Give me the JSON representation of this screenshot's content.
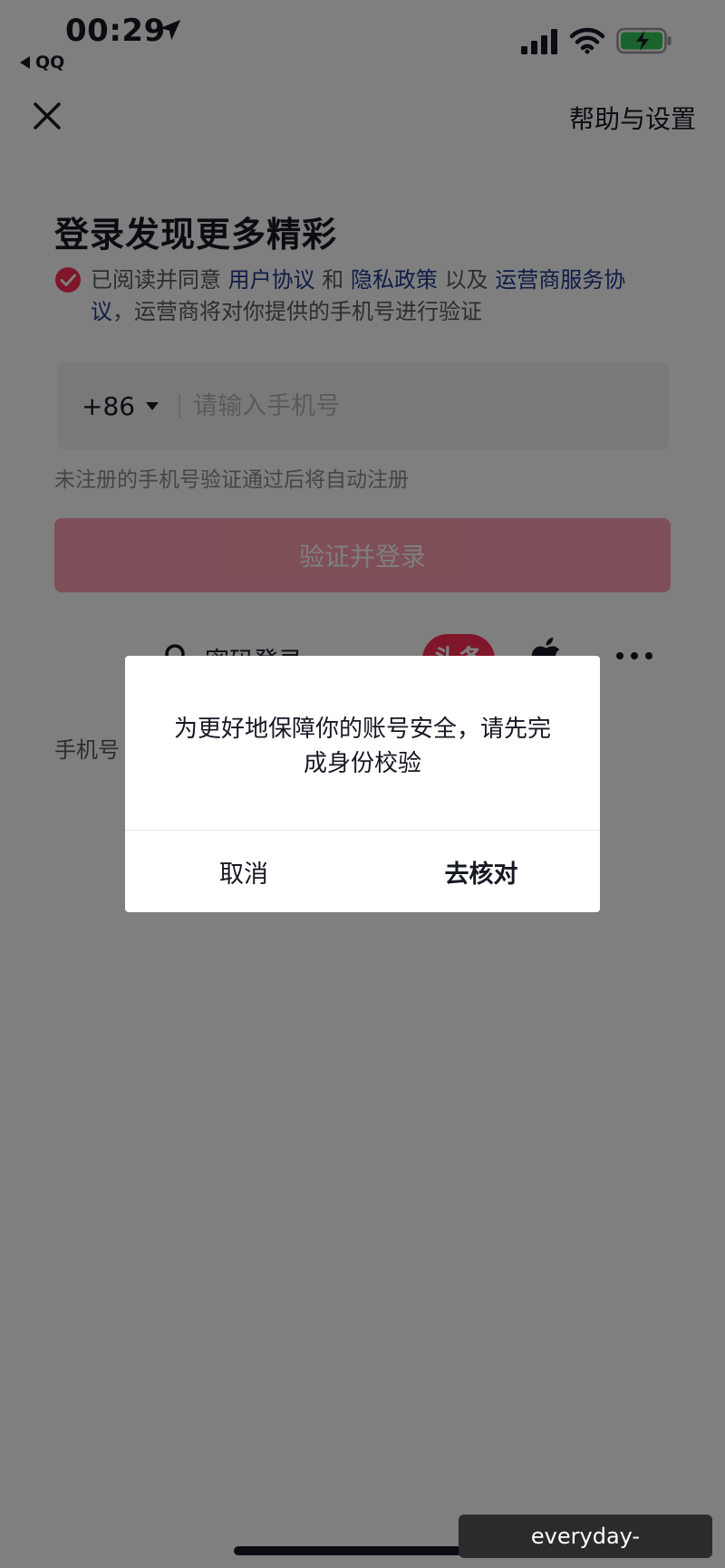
{
  "status_bar": {
    "time": "00:29",
    "back_app": "QQ"
  },
  "header": {
    "help_label": "帮助与设置"
  },
  "login": {
    "title": "登录发现更多精彩",
    "agreement": {
      "prefix": "已阅读并同意",
      "user_agreement": "用户协议",
      "and": "和",
      "privacy_policy": "隐私政策",
      "also": "以及",
      "carrier_agreement": "运营商服务协议",
      "suffix": "，运营商将对你提供的手机号进行验证"
    },
    "country_code": "+86",
    "phone_placeholder": "请输入手机号",
    "hint": "未注册的手机号验证通过后将自动注册",
    "submit_label": "验证并登录",
    "password_login": "密码登录",
    "badge_text": "头条",
    "foot_note": "手机号"
  },
  "dialog": {
    "message": "为更好地保障你的账号安全，请先完成身份校验",
    "cancel_label": "取消",
    "confirm_label": "去核对"
  },
  "watermark": "everyday-kaiyun.com.cn",
  "colors": {
    "accent": "#fe2c55",
    "link": "#1e3a8a",
    "text": "#161823"
  }
}
